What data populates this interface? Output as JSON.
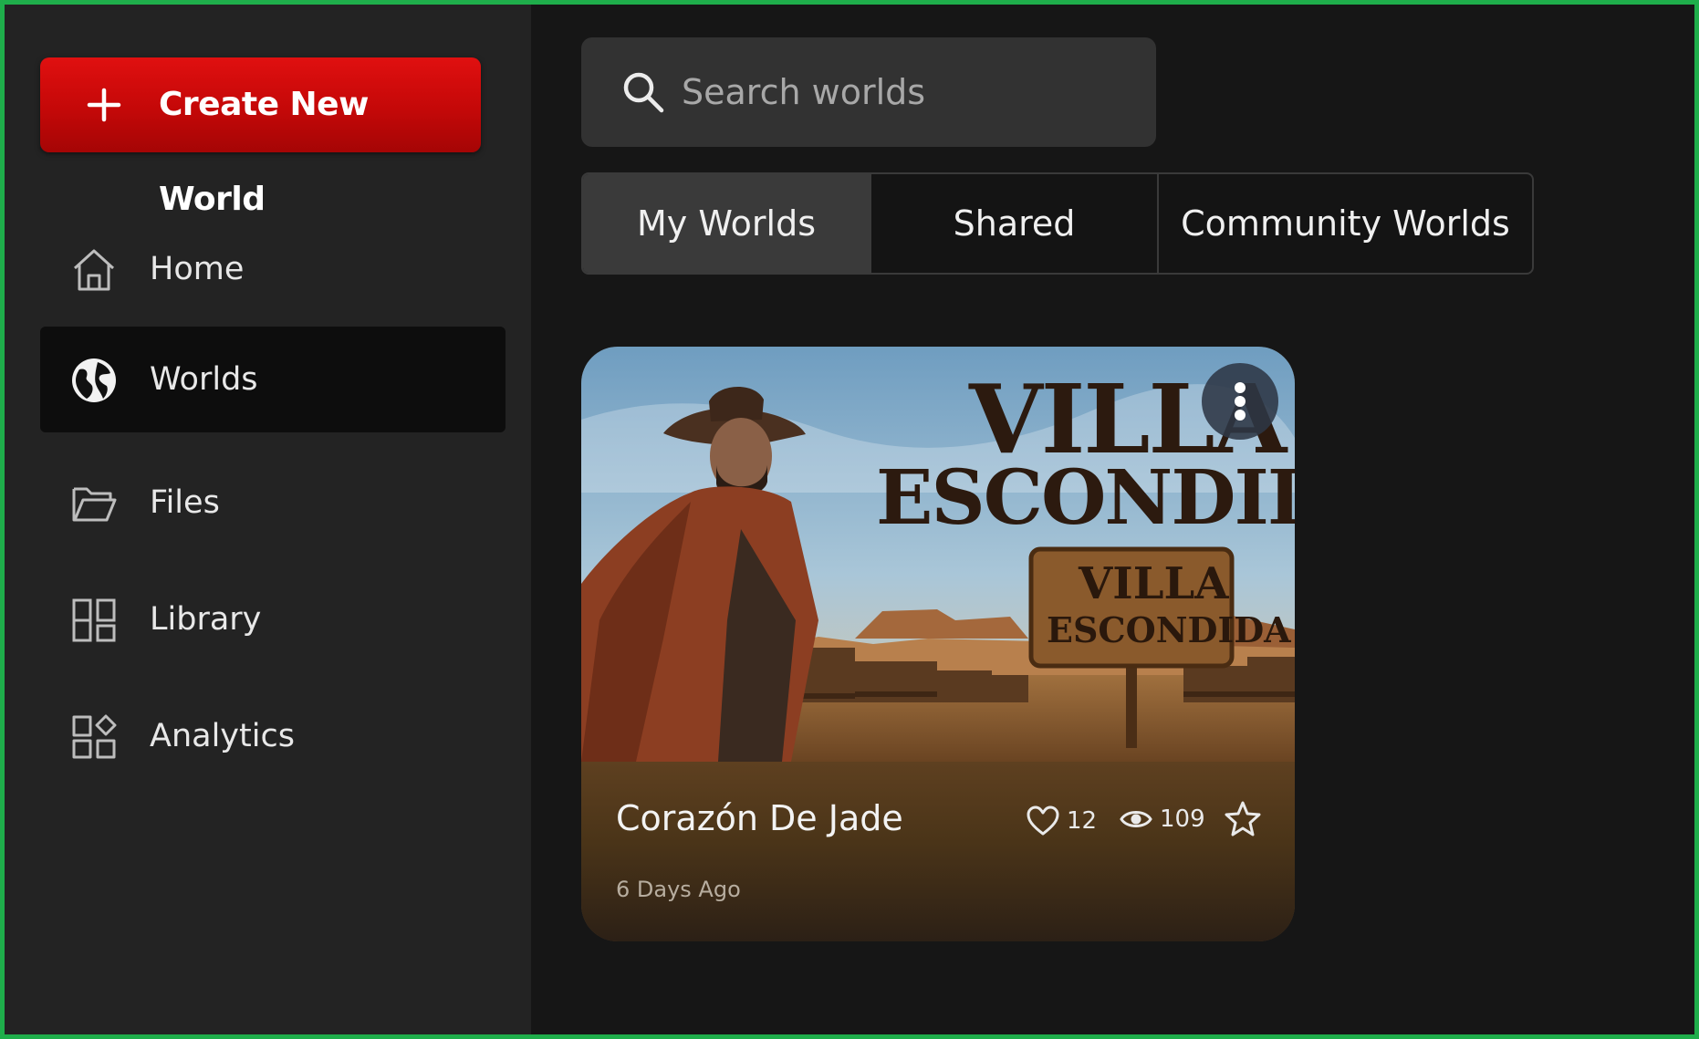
{
  "colors": {
    "accent_red": "#d20a0a",
    "frame_green": "#1fae4b",
    "sidebar_bg": "#232323",
    "main_bg": "#161616"
  },
  "sidebar": {
    "create_button": {
      "label": "Create New World",
      "icon": "plus-icon"
    },
    "items": [
      {
        "label": "Home",
        "icon": "home-icon",
        "active": false
      },
      {
        "label": "Worlds",
        "icon": "globe-icon",
        "active": true
      },
      {
        "label": "Files",
        "icon": "folder-icon",
        "active": false
      },
      {
        "label": "Library",
        "icon": "library-icon",
        "active": false
      },
      {
        "label": "Analytics",
        "icon": "analytics-icon",
        "active": false
      }
    ]
  },
  "search": {
    "placeholder": "Search worlds",
    "value": "",
    "icon": "search-icon"
  },
  "tabs": [
    {
      "label": "My Worlds",
      "active": true
    },
    {
      "label": "Shared",
      "active": false
    },
    {
      "label": "Community Worlds",
      "active": false
    }
  ],
  "worlds": [
    {
      "title": "Corazón De Jade",
      "updated": "6 Days Ago",
      "likes": "12",
      "views": "109",
      "favorited": false,
      "thumbnail": {
        "headline_line1": "VILLA",
        "headline_line2": "ESCONDIDA",
        "sign_line1": "VILLA",
        "sign_line2": "ESCONDIDA"
      }
    }
  ]
}
